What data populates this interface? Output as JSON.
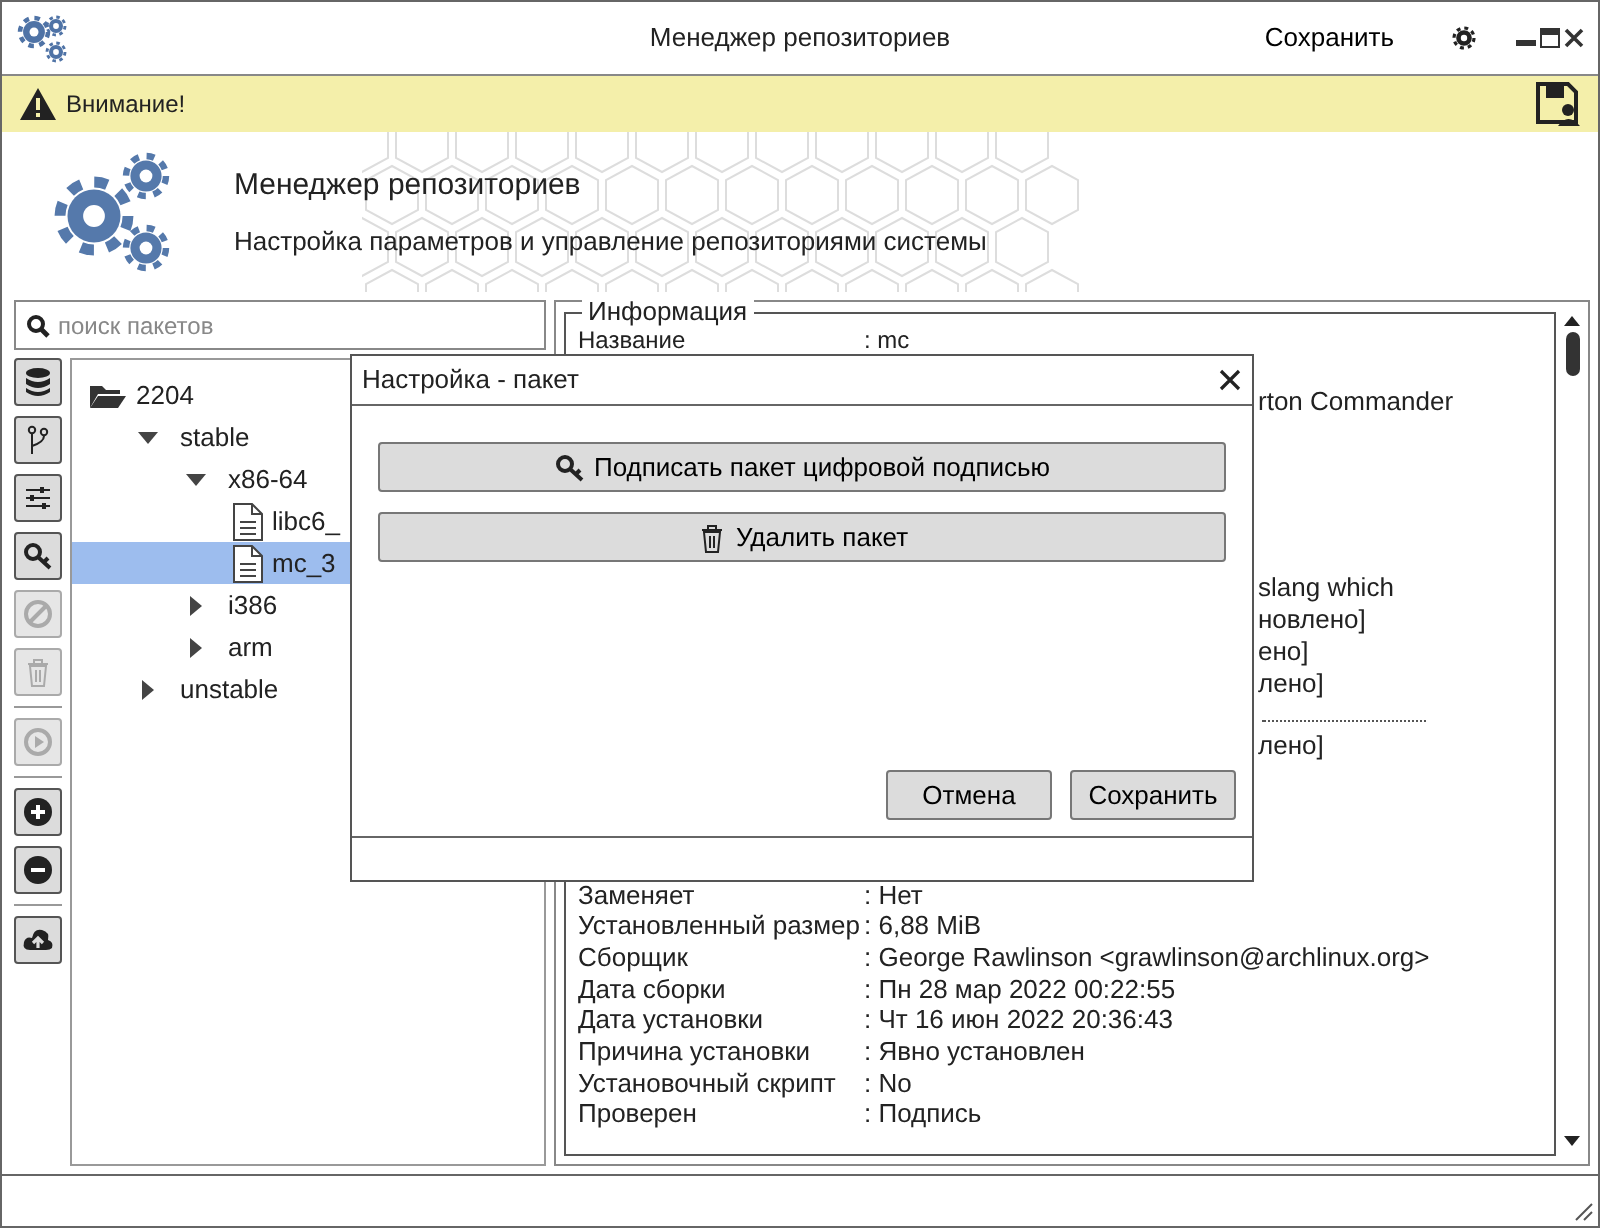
{
  "window": {
    "title": "Менеджер репозиториев",
    "save_label": "Сохранить"
  },
  "alert": {
    "text": "Внимание!"
  },
  "header": {
    "title": "Менеджер репозиториев",
    "subtitle": "Настройка параметров и управление репозиториями системы"
  },
  "search": {
    "placeholder": "поиск пакетов"
  },
  "toolbar": [
    {
      "kind": "database",
      "disabled": false
    },
    {
      "kind": "branch",
      "disabled": false
    },
    {
      "kind": "sliders",
      "disabled": false
    },
    {
      "kind": "key",
      "disabled": false
    },
    {
      "kind": "ban",
      "disabled": true
    },
    {
      "kind": "trash",
      "disabled": true
    },
    {
      "kind": "separator"
    },
    {
      "kind": "play",
      "disabled": true
    },
    {
      "kind": "separator"
    },
    {
      "kind": "plus",
      "disabled": false
    },
    {
      "kind": "minus",
      "disabled": false
    },
    {
      "kind": "separator"
    },
    {
      "kind": "upload",
      "disabled": false
    }
  ],
  "tree": [
    {
      "kind": "folder",
      "label": "2204",
      "expanded": true,
      "selected": false,
      "children": [
        {
          "kind": "branch",
          "label": "stable",
          "expanded": true,
          "selected": false,
          "children": [
            {
              "kind": "branch",
              "label": "x86-64",
              "expanded": true,
              "selected": false,
              "children": [
                {
                  "kind": "file",
                  "label": "libc6_",
                  "selected": false
                },
                {
                  "kind": "file",
                  "label": "mc_3",
                  "selected": true
                }
              ]
            },
            {
              "kind": "branch",
              "label": "i386",
              "expanded": false,
              "selected": false
            },
            {
              "kind": "branch",
              "label": "arm",
              "expanded": false,
              "selected": false
            }
          ]
        },
        {
          "kind": "branch",
          "label": "unstable",
          "expanded": false,
          "selected": false
        }
      ]
    }
  ],
  "info": {
    "legend": "Информация",
    "top_rows": [
      {
        "label": "Название",
        "value": ": mc"
      }
    ],
    "fragments": [
      "rton Commander",
      "slang  which",
      "новлено]",
      "ено]",
      "лено]",
      "лено]"
    ],
    "rows": [
      {
        "label": "Заменяет",
        "value": ": Нет"
      },
      {
        "label": "Установленный размер",
        "value": ": 6,88 MiB"
      },
      {
        "label": "Сборщик",
        "value": ": George Rawlinson <grawlinson@archlinux.org>"
      },
      {
        "label": "Дата сборки",
        "value": ": Пн 28 мар 2022 00:22:55"
      },
      {
        "label": "Дата установки",
        "value": ": Чт 16 июн 2022 20:36:43"
      },
      {
        "label": "Причина установки",
        "value": ": Явно установлен"
      },
      {
        "label": "Установочный скрипт",
        "value": ": No"
      },
      {
        "label": "Проверен",
        "value": ": Подпись"
      }
    ]
  },
  "dialog": {
    "title": "Настройка - пакет",
    "actions": [
      {
        "kind": "sign",
        "label": "Подписать пакет цифровой подписью"
      },
      {
        "kind": "delete",
        "label": "Удалить пакет"
      }
    ],
    "buttons": [
      "Отмена",
      "Сохранить"
    ]
  }
}
